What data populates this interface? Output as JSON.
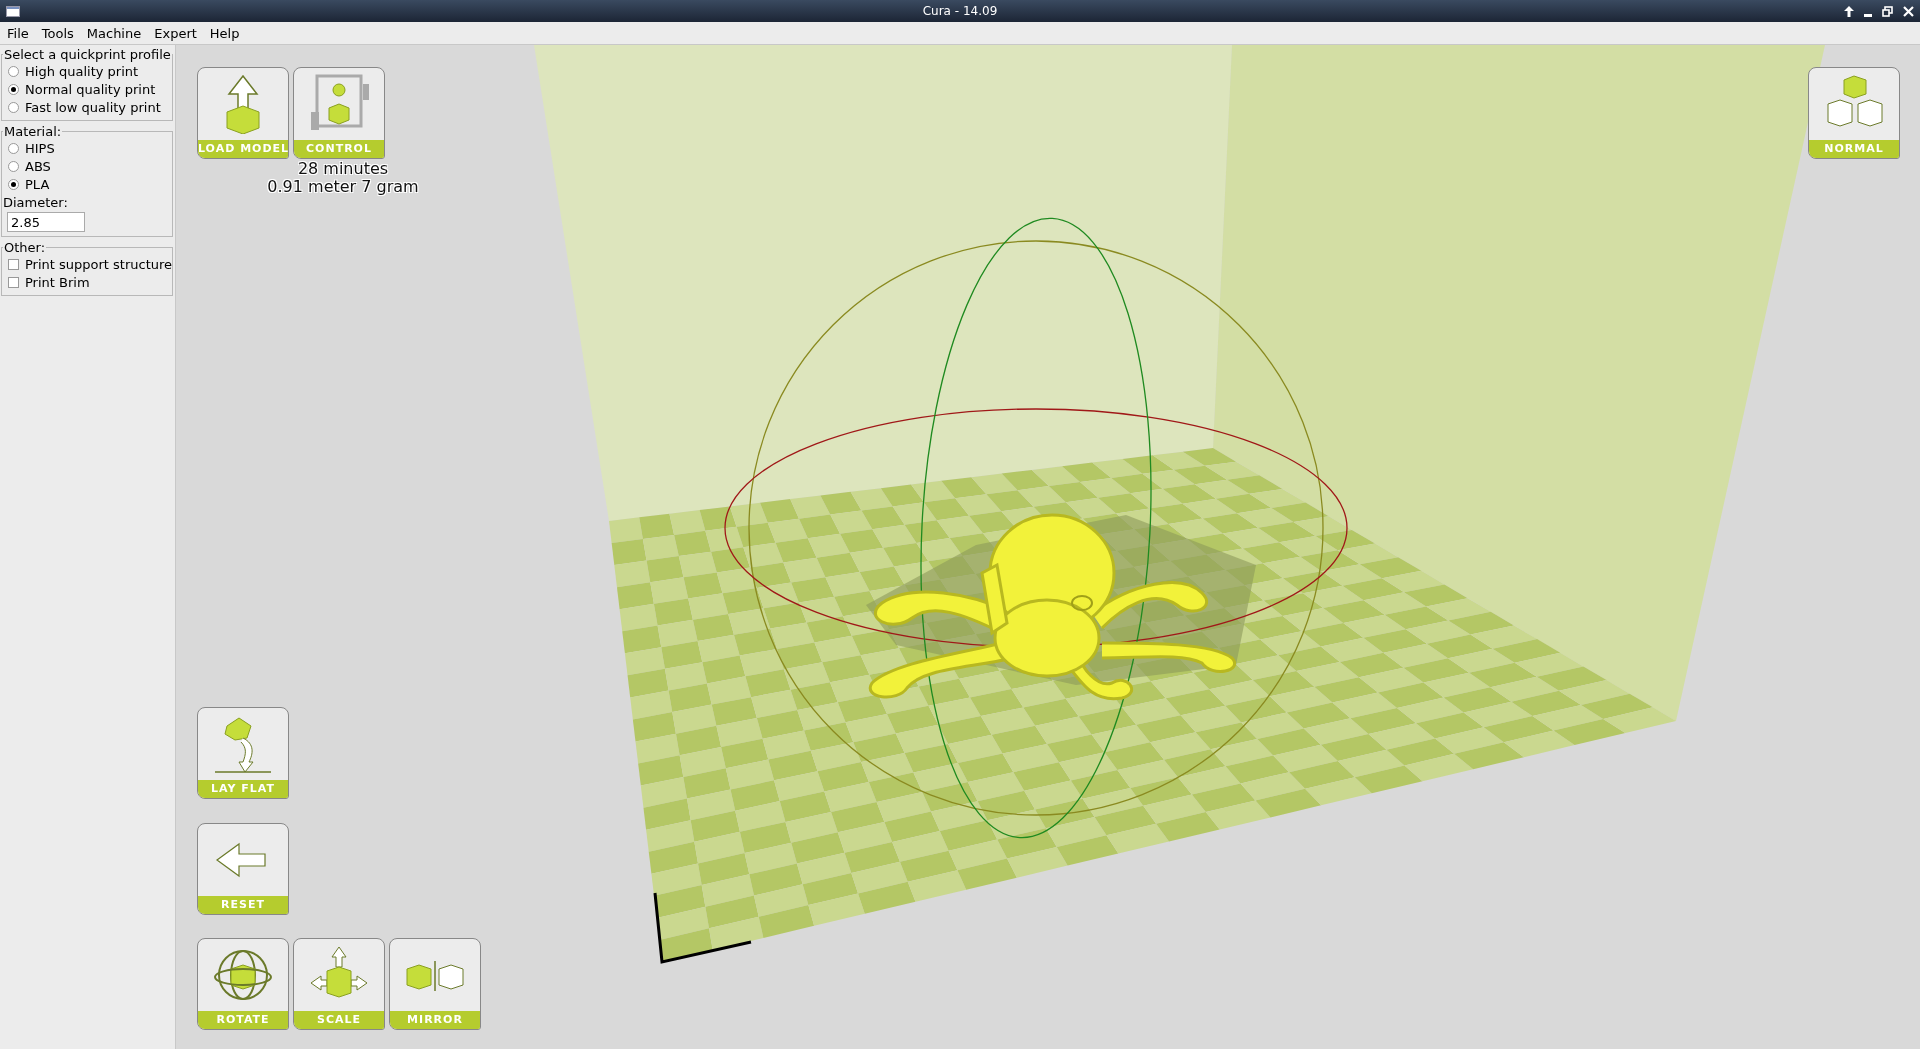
{
  "window": {
    "title": "Cura - 14.09"
  },
  "menu": [
    {
      "label": "File"
    },
    {
      "label": "Tools"
    },
    {
      "label": "Machine"
    },
    {
      "label": "Expert"
    },
    {
      "label": "Help"
    }
  ],
  "profile": {
    "title": "Select a quickprint profile",
    "options": [
      {
        "label": "High quality print",
        "selected": false
      },
      {
        "label": "Normal quality print",
        "selected": true
      },
      {
        "label": "Fast low quality print",
        "selected": false
      }
    ]
  },
  "material": {
    "title": "Material:",
    "options": [
      {
        "label": "HIPS",
        "selected": false
      },
      {
        "label": "ABS",
        "selected": false
      },
      {
        "label": "PLA",
        "selected": true
      }
    ],
    "diameter_label": "Diameter:",
    "diameter_value": "2.85"
  },
  "other": {
    "title": "Other:",
    "options": [
      {
        "label": "Print support structure",
        "checked": false
      },
      {
        "label": "Print Brim",
        "checked": false
      }
    ]
  },
  "top_toolbar": [
    {
      "kind": "load",
      "label": "LOAD MODEL"
    },
    {
      "kind": "control",
      "label": "CONTROL"
    }
  ],
  "print_info": [
    "28 minutes",
    "0.91 meter 7 gram"
  ],
  "view_mode": {
    "kind": "normal",
    "label": "NORMAL"
  },
  "side_tools": [
    {
      "kind": "layflat",
      "label": "LAY FLAT"
    },
    {
      "kind": "reset",
      "label": "RESET"
    }
  ],
  "bottom_tools": [
    {
      "kind": "rotate",
      "label": "ROTATE"
    },
    {
      "kind": "scale",
      "label": "SCALE"
    },
    {
      "kind": "mirror",
      "label": "MIRROR"
    }
  ]
}
